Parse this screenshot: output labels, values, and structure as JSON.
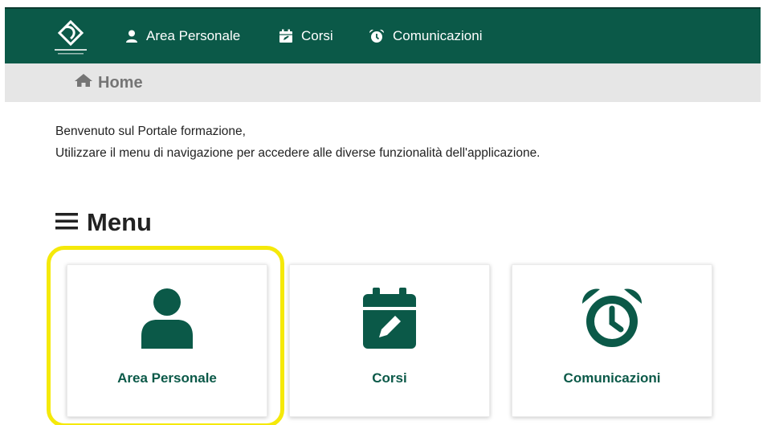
{
  "colors": {
    "brand": "#0b5948",
    "breadcrumb_bg": "#e6e6e6",
    "highlight": "#f5e90a"
  },
  "topbar": {
    "logo_icon": "school-logo-icon",
    "nav": [
      {
        "label": "Area Personale",
        "icon": "user-icon"
      },
      {
        "label": "Corsi",
        "icon": "calendar-edit-icon"
      },
      {
        "label": "Comunicazioni",
        "icon": "alarm-clock-icon"
      }
    ]
  },
  "breadcrumb": {
    "icon": "home-icon",
    "label": "Home"
  },
  "welcome": {
    "line1": "Benvenuto sul Portale formazione,",
    "line2": "Utilizzare il menu di navigazione per accedere alle diverse funzionalità dell'applicazione."
  },
  "menu": {
    "title": "Menu",
    "icon": "hamburger-icon",
    "cards": [
      {
        "label": "Area Personale",
        "icon": "user-icon",
        "highlighted": true
      },
      {
        "label": "Corsi",
        "icon": "calendar-edit-icon",
        "highlighted": false
      },
      {
        "label": "Comunicazioni",
        "icon": "alarm-clock-icon",
        "highlighted": false
      }
    ]
  }
}
